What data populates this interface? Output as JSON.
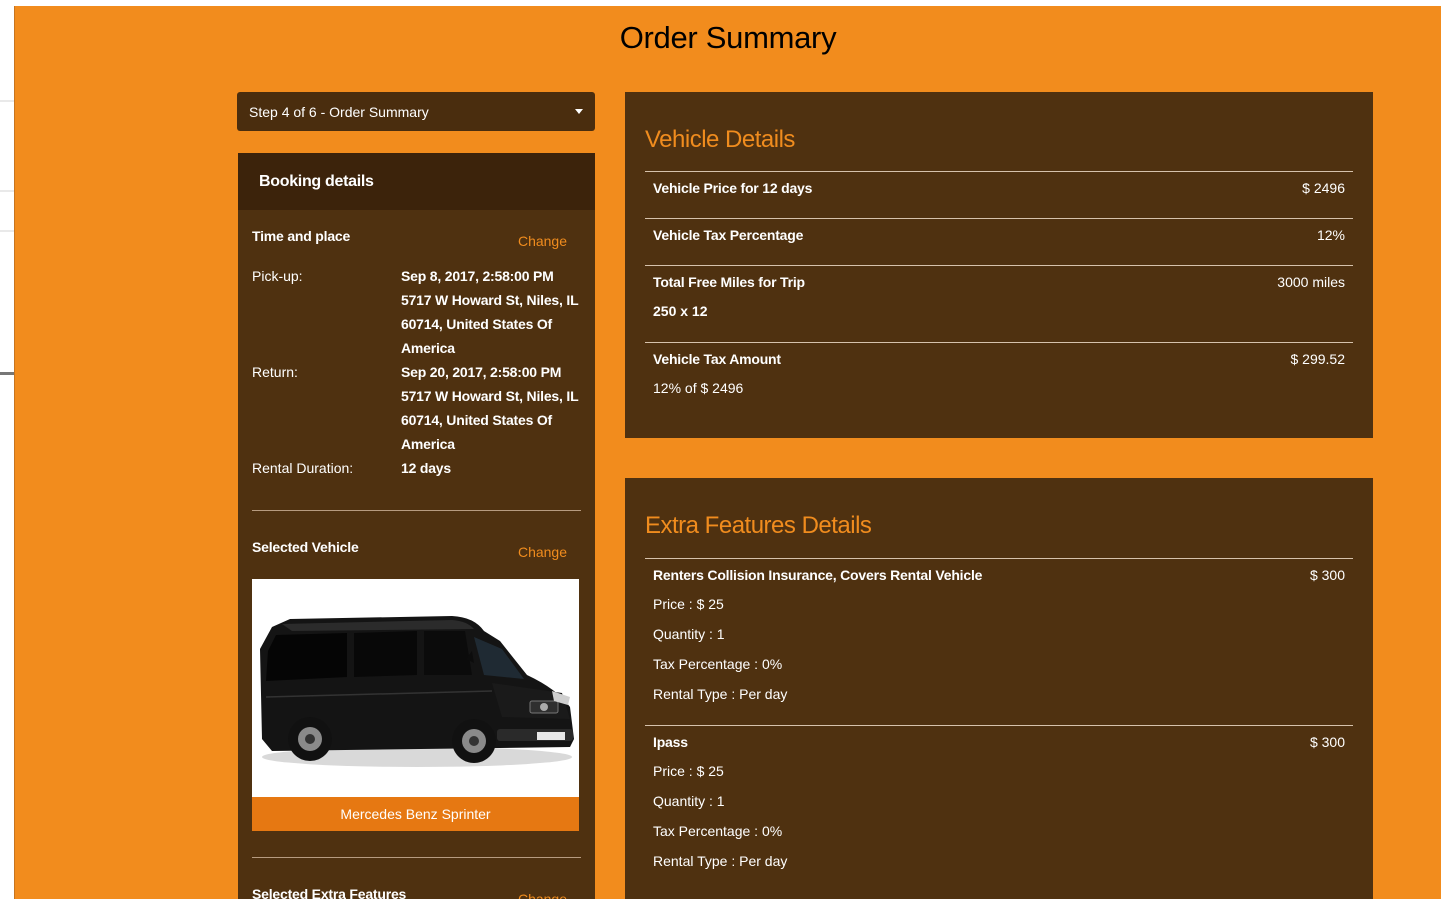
{
  "page": {
    "title": "Order Summary",
    "step_label": "Step 4 of 6 - Order Summary"
  },
  "booking": {
    "header": "Booking details",
    "time_place": {
      "title": "Time and place",
      "change": "Change",
      "pickup_label": "Pick-up:",
      "pickup_value": "Sep 8, 2017, 2:58:00 PM 5717 W Howard St, Niles, IL 60714, United States Of America",
      "return_label": "Return:",
      "return_value": "Sep 20, 2017, 2:58:00 PM 5717 W Howard St, Niles, IL 60714, United States Of America",
      "duration_label": "Rental Duration:",
      "duration_value": "12 days"
    },
    "vehicle": {
      "title": "Selected Vehicle",
      "change": "Change",
      "name": "Mercedes Benz Sprinter"
    },
    "extras": {
      "title": "Selected Extra Features",
      "change": "Change"
    }
  },
  "vehicle_details": {
    "title": "Vehicle Details",
    "rows": [
      {
        "label": "Vehicle Price for 12 days",
        "amount": "$ 2496"
      },
      {
        "label": "Vehicle Tax Percentage",
        "amount": "12%"
      },
      {
        "label": "Total Free Miles for Trip",
        "amount": "3000 miles",
        "sub": "250 x 12"
      },
      {
        "label": "Vehicle Tax Amount",
        "amount": "$ 299.52",
        "sub": "12% of $ 2496"
      }
    ]
  },
  "extra_features": {
    "title": "Extra Features Details",
    "items": [
      {
        "label": "Renters Collision Insurance, Covers Rental Vehicle",
        "amount": "$ 300",
        "price": "Price : $ 25",
        "quantity": "Quantity : 1",
        "tax": "Tax Percentage : 0%",
        "rental_type": "Rental Type : Per day"
      },
      {
        "label": "Ipass",
        "amount": "$ 300",
        "price": "Price : $ 25",
        "quantity": "Quantity : 1",
        "tax": "Tax Percentage : 0%",
        "rental_type": "Rental Type : Per day"
      }
    ]
  },
  "colors": {
    "page_bg": "#f28c1d",
    "panel_bg": "#4f3110",
    "accent": "#f08c1e",
    "button": "#e67812"
  },
  "icons": {
    "dropdown": "caret-down-icon",
    "vehicle": "van-image"
  }
}
